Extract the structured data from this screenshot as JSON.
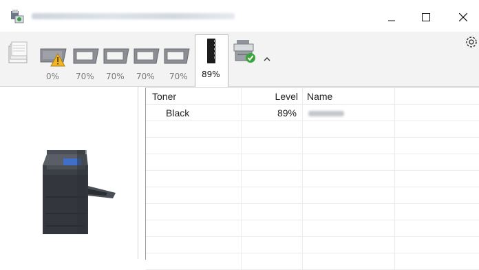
{
  "window": {
    "minimize_glyph": "—",
    "maximize_glyph": "☐",
    "close_glyph": "✕"
  },
  "toolbar": {
    "items": [
      {
        "name": "paper-stack",
        "label": ""
      },
      {
        "name": "toner-1",
        "label": "0%",
        "warning": true
      },
      {
        "name": "toner-2",
        "label": "70%"
      },
      {
        "name": "toner-3",
        "label": "70%"
      },
      {
        "name": "toner-4",
        "label": "70%"
      },
      {
        "name": "toner-5",
        "label": "70%"
      },
      {
        "name": "toner-black",
        "label": "89%",
        "active": true
      },
      {
        "name": "device-status",
        "label": ""
      }
    ]
  },
  "table": {
    "headers": [
      "Toner",
      "Level",
      "Name",
      ""
    ],
    "rows": [
      {
        "toner": "Black",
        "level": "89%",
        "name": ""
      }
    ],
    "empty_rows": 9
  },
  "colors": {
    "toolbar_bg": "#f3f3f3",
    "warning": "#f2b622",
    "ok_check": "#3aa53a"
  },
  "icons": [
    "app-icon",
    "settings-gear-icon",
    "paper-stack-icon",
    "toner-cartridge-icon",
    "warning-icon",
    "black-toner-icon",
    "device-ok-icon",
    "collapse-chevron-icon",
    "printer-image"
  ]
}
